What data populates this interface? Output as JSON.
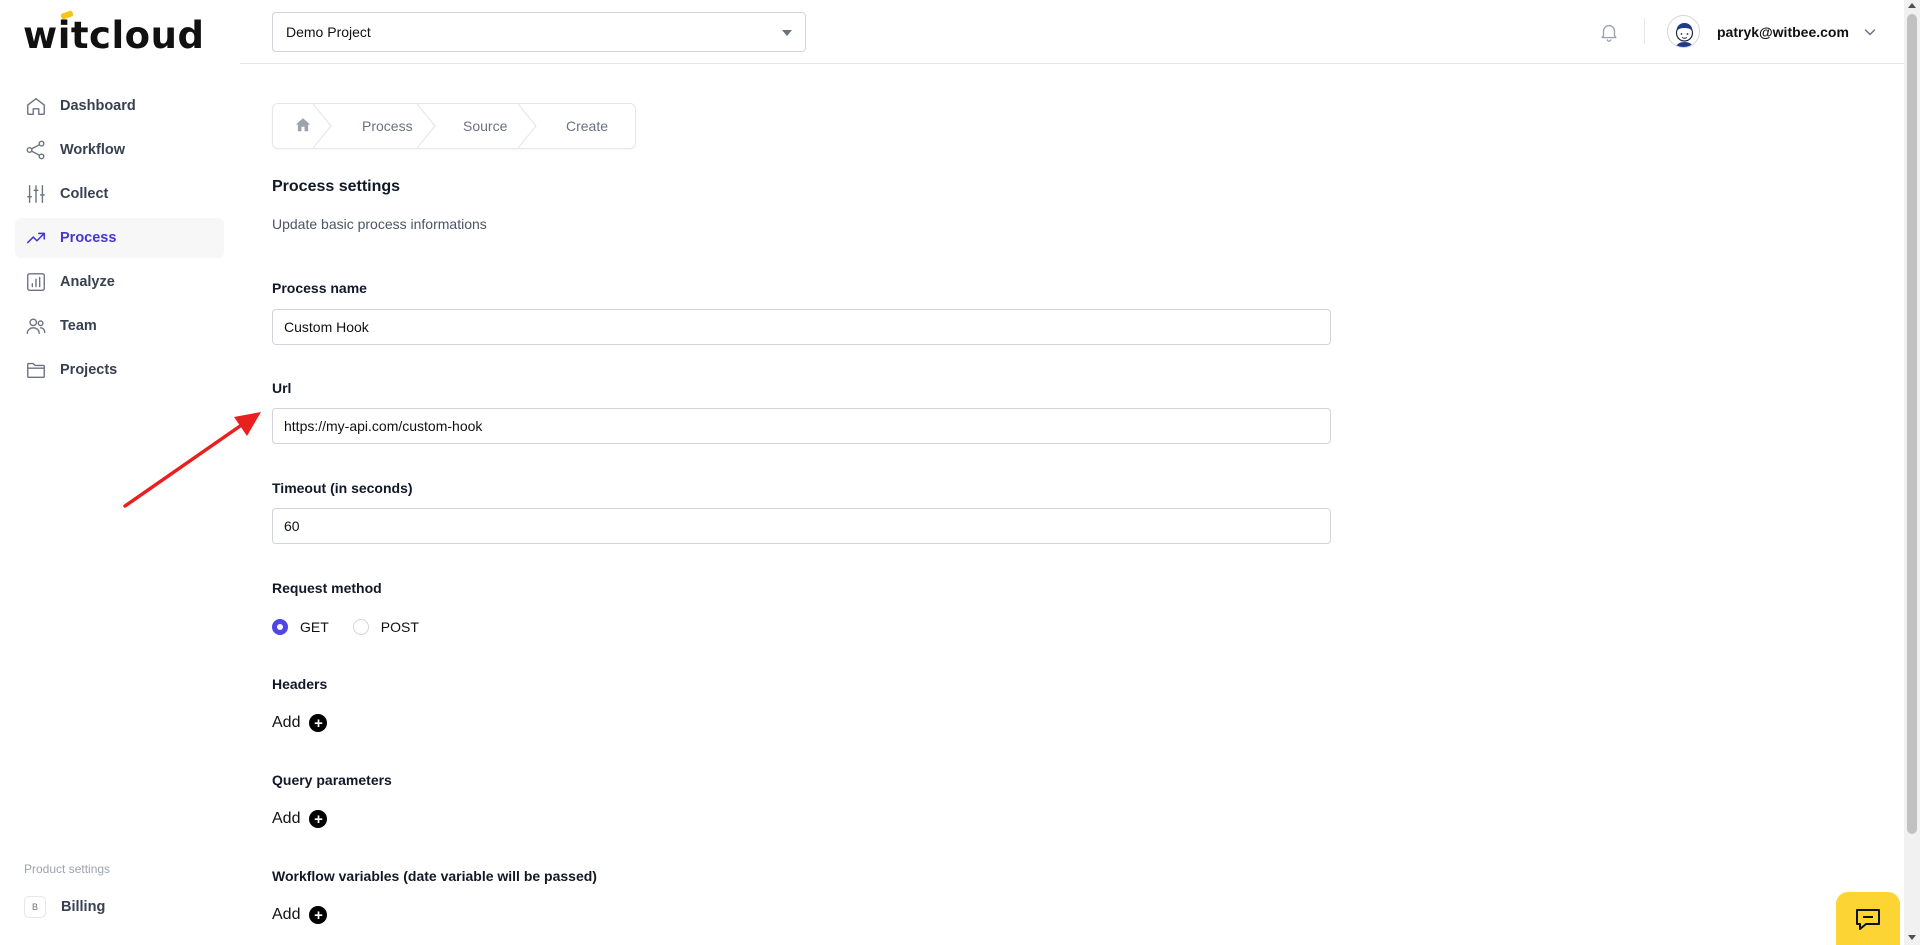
{
  "brand": {
    "logo_text": "witcloud"
  },
  "sidebar": {
    "items": [
      {
        "label": "Dashboard",
        "icon": "home-icon",
        "active": false
      },
      {
        "label": "Workflow",
        "icon": "share-icon",
        "active": false
      },
      {
        "label": "Collect",
        "icon": "sliders-icon",
        "active": false
      },
      {
        "label": "Process",
        "icon": "trending-up-icon",
        "active": true
      },
      {
        "label": "Analyze",
        "icon": "bar-chart-icon",
        "active": false
      },
      {
        "label": "Team",
        "icon": "users-icon",
        "active": false
      },
      {
        "label": "Projects",
        "icon": "folder-icon",
        "active": false
      }
    ],
    "product_settings_label": "Product settings",
    "billing": {
      "badge": "B",
      "label": "Billing"
    }
  },
  "header": {
    "project_select": "Demo Project",
    "user_email": "patryk@witbee.com"
  },
  "breadcrumb": [
    "Process",
    "Source",
    "Create"
  ],
  "form": {
    "title": "Process settings",
    "subtitle": "Update basic process informations",
    "process_name_label": "Process name",
    "process_name_value": "Custom Hook",
    "url_label": "Url",
    "url_value": "https://my-api.com/custom-hook",
    "timeout_label": "Timeout (in seconds)",
    "timeout_value": "60",
    "request_method_label": "Request method",
    "methods": [
      {
        "label": "GET",
        "checked": true
      },
      {
        "label": "POST",
        "checked": false
      }
    ],
    "headers_label": "Headers",
    "query_params_label": "Query parameters",
    "workflow_vars_label": "Workflow variables (date variable will be passed)",
    "add_label": "Add"
  },
  "colors": {
    "accent": "#4f46e5",
    "annotation_arrow": "#e8201f",
    "chat_button": "#fcd535"
  }
}
